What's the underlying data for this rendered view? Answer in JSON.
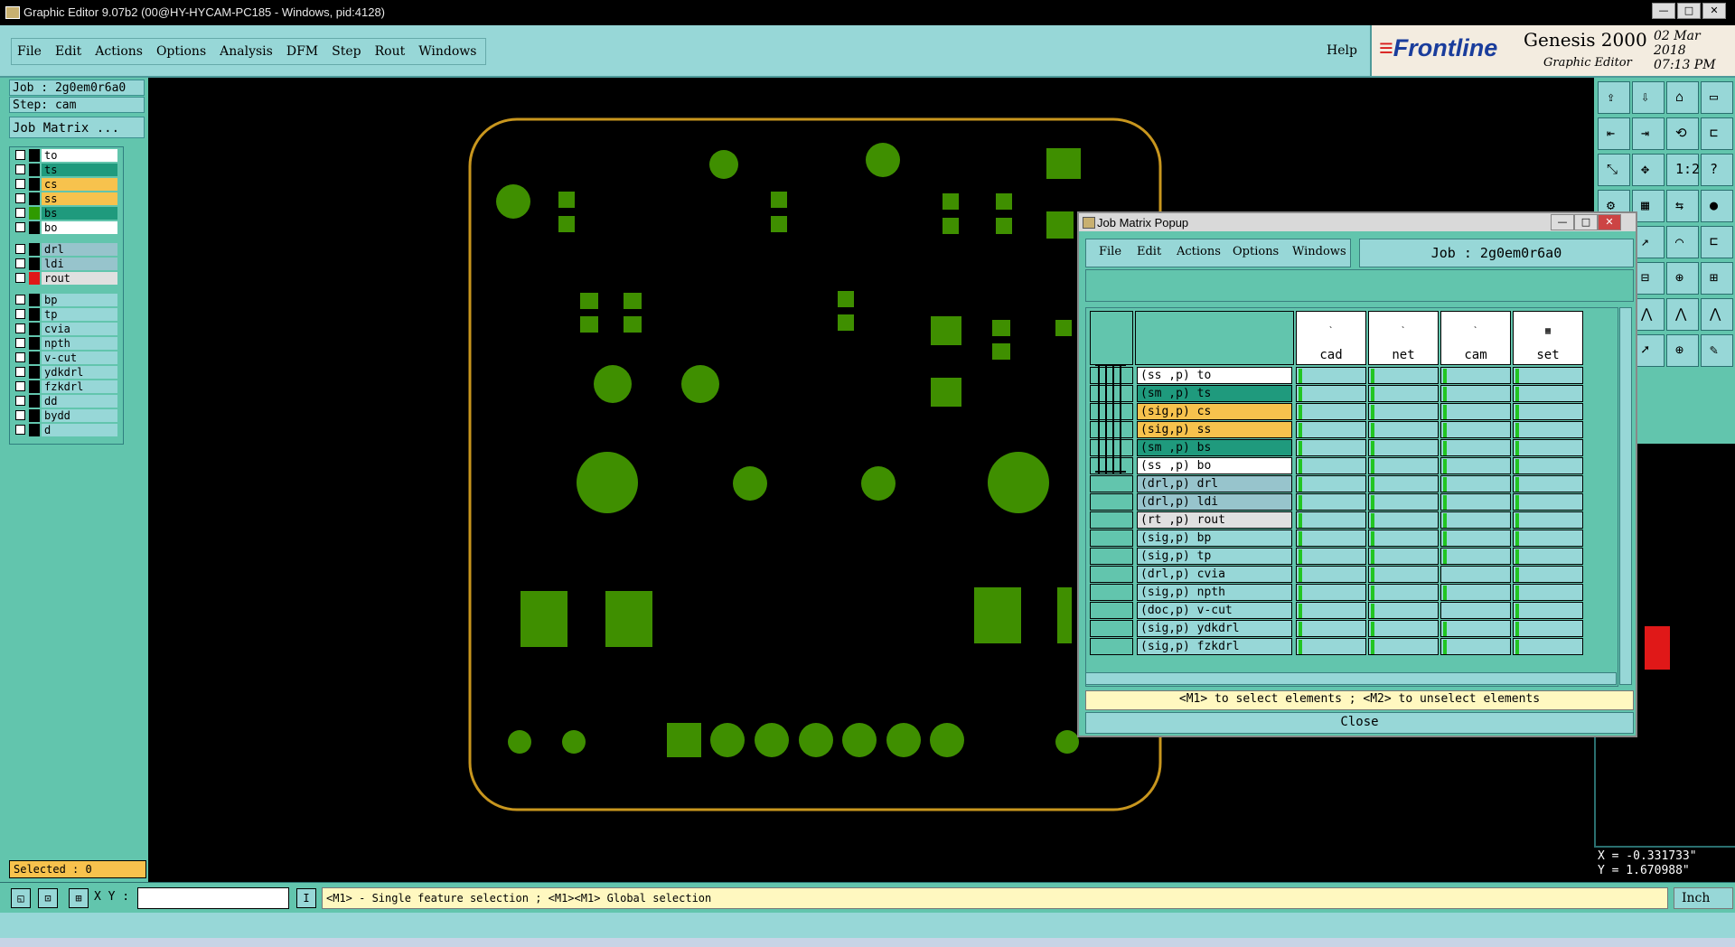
{
  "window": {
    "title": "Graphic Editor 9.07b2 (00@HY-HYCAM-PC185 - Windows, pid:4128)"
  },
  "menubar": {
    "items": [
      "File",
      "Edit",
      "Actions",
      "Options",
      "Analysis",
      "DFM",
      "Step",
      "Rout",
      "Windows"
    ],
    "help": "Help"
  },
  "brand": {
    "logo": "Frontline",
    "product": "Genesis 2000",
    "subtitle": "Graphic Editor",
    "date": "02 Mar 2018",
    "time": "07:13 PM"
  },
  "left_panel": {
    "job": "Job : 2g0em0r6a0",
    "step": "Step: cam",
    "job_matrix_button": "Job Matrix ...",
    "layers": [
      {
        "name": "to",
        "color": "#ffffff",
        "swatch": "#000000"
      },
      {
        "name": "ts",
        "color": "#1f9a7d",
        "swatch": "#000000"
      },
      {
        "name": "cs",
        "color": "#f7c24d",
        "swatch": "#000000"
      },
      {
        "name": "ss",
        "color": "#f7c24d",
        "swatch": "#000000"
      },
      {
        "name": "bs",
        "color": "#1f9a7d",
        "swatch": "#2f9a00"
      },
      {
        "name": "bo",
        "color": "#ffffff",
        "swatch": "#000000"
      },
      {
        "name": "drl",
        "color": "#97c4cc",
        "swatch": "#000000"
      },
      {
        "name": "ldi",
        "color": "#97c4cc",
        "swatch": "#000000"
      },
      {
        "name": "rout",
        "color": "#e0e0e0",
        "swatch": "#e01818"
      },
      {
        "name": "bp",
        "color": "#97d7d7",
        "swatch": "#000000"
      },
      {
        "name": "tp",
        "color": "#97d7d7",
        "swatch": "#000000"
      },
      {
        "name": "cvia",
        "color": "#97d7d7",
        "swatch": "#000000"
      },
      {
        "name": "npth",
        "color": "#97d7d7",
        "swatch": "#000000"
      },
      {
        "name": "v-cut",
        "color": "#97d7d7",
        "swatch": "#000000"
      },
      {
        "name": "ydkdrl",
        "color": "#97d7d7",
        "swatch": "#000000"
      },
      {
        "name": "fzkdrl",
        "color": "#97d7d7",
        "swatch": "#000000"
      },
      {
        "name": "dd",
        "color": "#97d7d7",
        "swatch": "#000000"
      },
      {
        "name": "bydd",
        "color": "#97d7d7",
        "swatch": "#000000"
      },
      {
        "name": "d",
        "color": "#97d7d7",
        "swatch": "#000000"
      }
    ],
    "selected": "Selected : 0"
  },
  "popup": {
    "title": "Job Matrix Popup",
    "menu": [
      "File",
      "Edit",
      "Actions",
      "Options",
      "Windows"
    ],
    "job": "Job : 2g0em0r6a0",
    "columns": [
      "cad",
      "net",
      "cam",
      "set"
    ],
    "rows": [
      {
        "label": "(ss ,p) to",
        "color": "#ffffff"
      },
      {
        "label": "(sm ,p) ts",
        "color": "#1f9a7d"
      },
      {
        "label": "(sig,p) cs",
        "color": "#f7c24d"
      },
      {
        "label": "(sig,p) ss",
        "color": "#f7c24d"
      },
      {
        "label": "(sm ,p) bs",
        "color": "#1f9a7d"
      },
      {
        "label": "(ss ,p) bo",
        "color": "#ffffff"
      },
      {
        "label": "(drl,p) drl",
        "color": "#97c4cc"
      },
      {
        "label": "(drl,p) ldi",
        "color": "#97c4cc"
      },
      {
        "label": "(rt ,p) rout",
        "color": "#e0e0e0"
      },
      {
        "label": "(sig,p) bp",
        "color": "#97d7d7"
      },
      {
        "label": "(sig,p) tp",
        "color": "#97d7d7"
      },
      {
        "label": "(drl,p) cvia",
        "color": "#97d7d7"
      },
      {
        "label": "(sig,p) npth",
        "color": "#97d7d7"
      },
      {
        "label": "(doc,p) v-cut",
        "color": "#97d7d7"
      },
      {
        "label": "(sig,p) ydkdrl",
        "color": "#97d7d7"
      },
      {
        "label": "(sig,p) fzkdrl",
        "color": "#97d7d7"
      }
    ],
    "status": "<M1> to select elements ; <M2> to unselect elements",
    "close": "Close"
  },
  "bottom": {
    "xy_label": "X Y :",
    "xy_value": "",
    "hint": "<M1> - Single feature selection ; <M1><M1> Global selection",
    "units": "Inch"
  },
  "coords": {
    "x": "X = -0.331733\"",
    "y": "Y = 1.670988\""
  },
  "colors": {
    "panel": "#62c5ad",
    "panel_light": "#97d7d7",
    "pad": "#3f8f00",
    "outline": "#c8961e"
  }
}
